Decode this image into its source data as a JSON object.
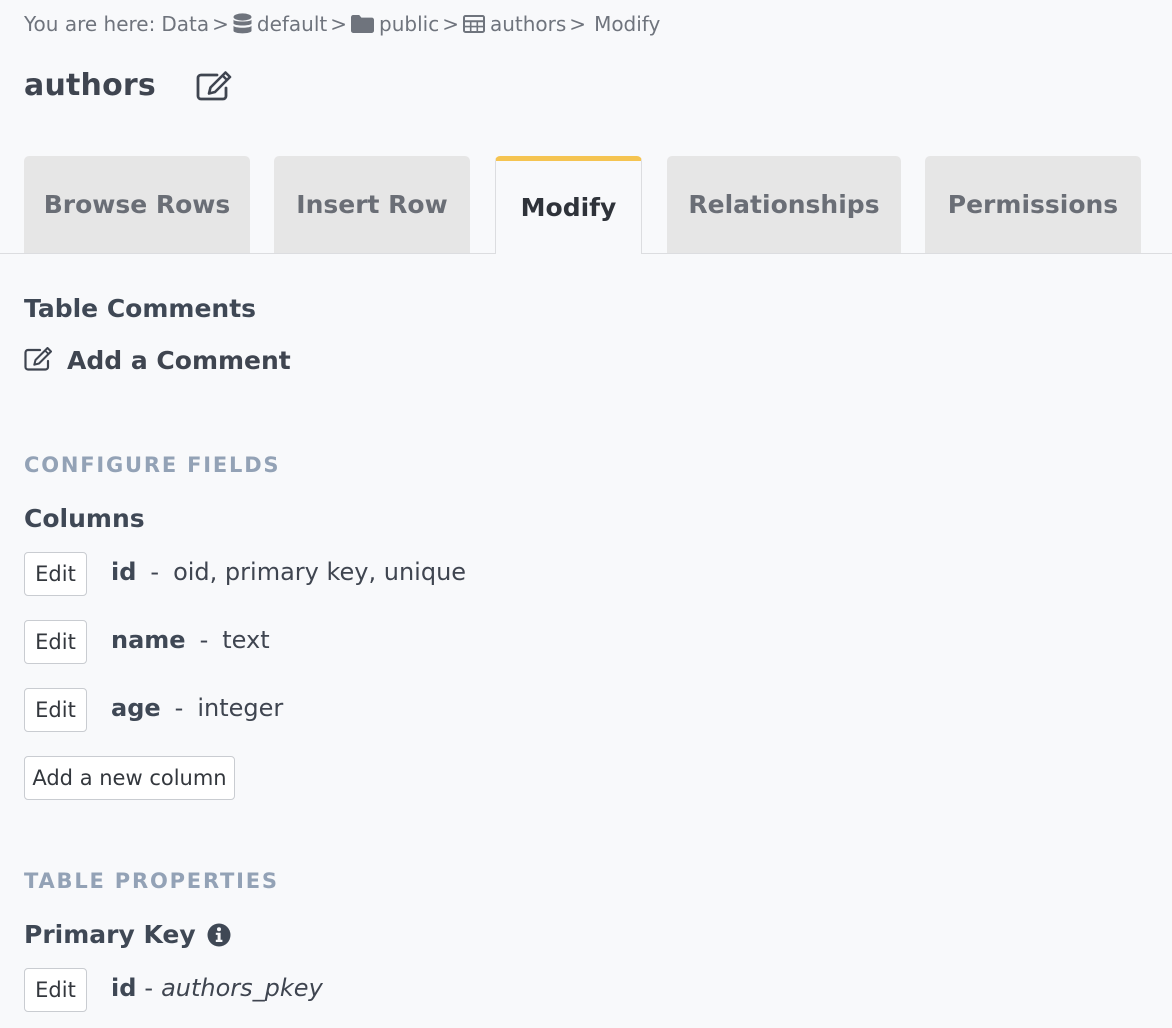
{
  "breadcrumb": {
    "prefix": "You are here:",
    "items": [
      {
        "label": "Data",
        "icon": null
      },
      {
        "label": "default",
        "icon": "database-icon"
      },
      {
        "label": "public",
        "icon": "folder-icon"
      },
      {
        "label": "authors",
        "icon": "table-icon"
      },
      {
        "label": "Modify",
        "icon": null
      }
    ],
    "separator": ">"
  },
  "page": {
    "title": "authors"
  },
  "tabs": [
    {
      "label": "Browse Rows",
      "active": false
    },
    {
      "label": "Insert Row",
      "active": false
    },
    {
      "label": "Modify",
      "active": true
    },
    {
      "label": "Relationships",
      "active": false
    },
    {
      "label": "Permissions",
      "active": false
    }
  ],
  "table_comments": {
    "heading": "Table Comments",
    "add_label": "Add a Comment"
  },
  "configure_fields": {
    "label": "CONFIGURE FIELDS",
    "columns_heading": "Columns",
    "edit_label": "Edit",
    "dash": "-",
    "columns": [
      {
        "name": "id",
        "type": "oid, primary key, unique"
      },
      {
        "name": "name",
        "type": "text"
      },
      {
        "name": "age",
        "type": "integer"
      }
    ],
    "add_column_label": "Add a new column"
  },
  "table_properties": {
    "label": "TABLE PROPERTIES",
    "primary_key_heading": "Primary Key",
    "edit_label": "Edit",
    "primary_key": {
      "column": "id",
      "dash": "-",
      "constraint": "authors_pkey"
    }
  },
  "colors": {
    "accent": "#f5c451",
    "section_label": "#93a2b6",
    "text": "#3f4550",
    "tab_bg": "#e6e6e6",
    "page_bg": "#f8f9fb"
  }
}
